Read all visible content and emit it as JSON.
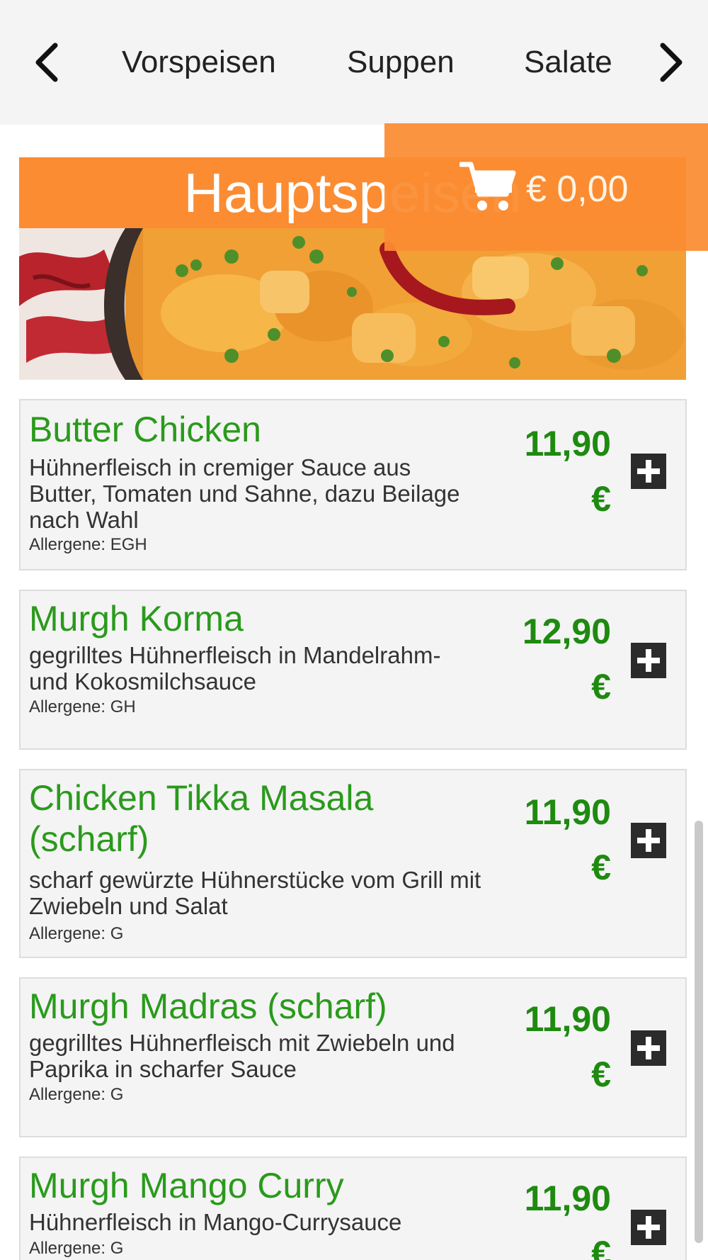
{
  "nav": {
    "categories": [
      "Vorspeisen",
      "Suppen",
      "Salate"
    ]
  },
  "section": {
    "title": "Hauptspeisen"
  },
  "cart": {
    "total": "€ 0,00"
  },
  "items": [
    {
      "name": "Butter Chicken",
      "description": "Hühnerfleisch in cremiger Sauce aus Butter, Tomaten und Sahne, dazu Beilage nach Wahl",
      "allergens": "Allergene: EGH",
      "price": "11,90",
      "currency": "€"
    },
    {
      "name": "Murgh Korma",
      "description": "gegrilltes Hühnerfleisch in Mandelrahm- und Kokosmilchsauce",
      "allergens": "Allergene: GH",
      "price": "12,90",
      "currency": "€"
    },
    {
      "name": "Chicken Tikka Masala (scharf)",
      "description": "scharf gewürzte Hühnerstücke vom Grill mit Zwiebeln und Salat",
      "allergens": "Allergene: G",
      "price": "11,90",
      "currency": "€"
    },
    {
      "name": "Murgh Madras (scharf)",
      "description": "gegrilltes Hühnerfleisch mit Zwiebeln und Paprika in scharfer Sauce",
      "allergens": "Allergene: G",
      "price": "11,90",
      "currency": "€"
    },
    {
      "name": "Murgh Mango Curry",
      "description": "Hühnerfleisch in Mango-Currysauce",
      "allergens": "Allergene: G",
      "price": "11,90",
      "currency": "€"
    }
  ],
  "colors": {
    "accent_orange": "#fb8c32",
    "item_name_green": "#2a9a1c",
    "price_green": "#1e8a10",
    "nav_background": "#f4f4f4"
  },
  "icons": {
    "nav_prev": "chevron-left-icon",
    "nav_next": "chevron-right-icon",
    "cart": "shopping-cart-icon",
    "add": "plus-icon"
  }
}
